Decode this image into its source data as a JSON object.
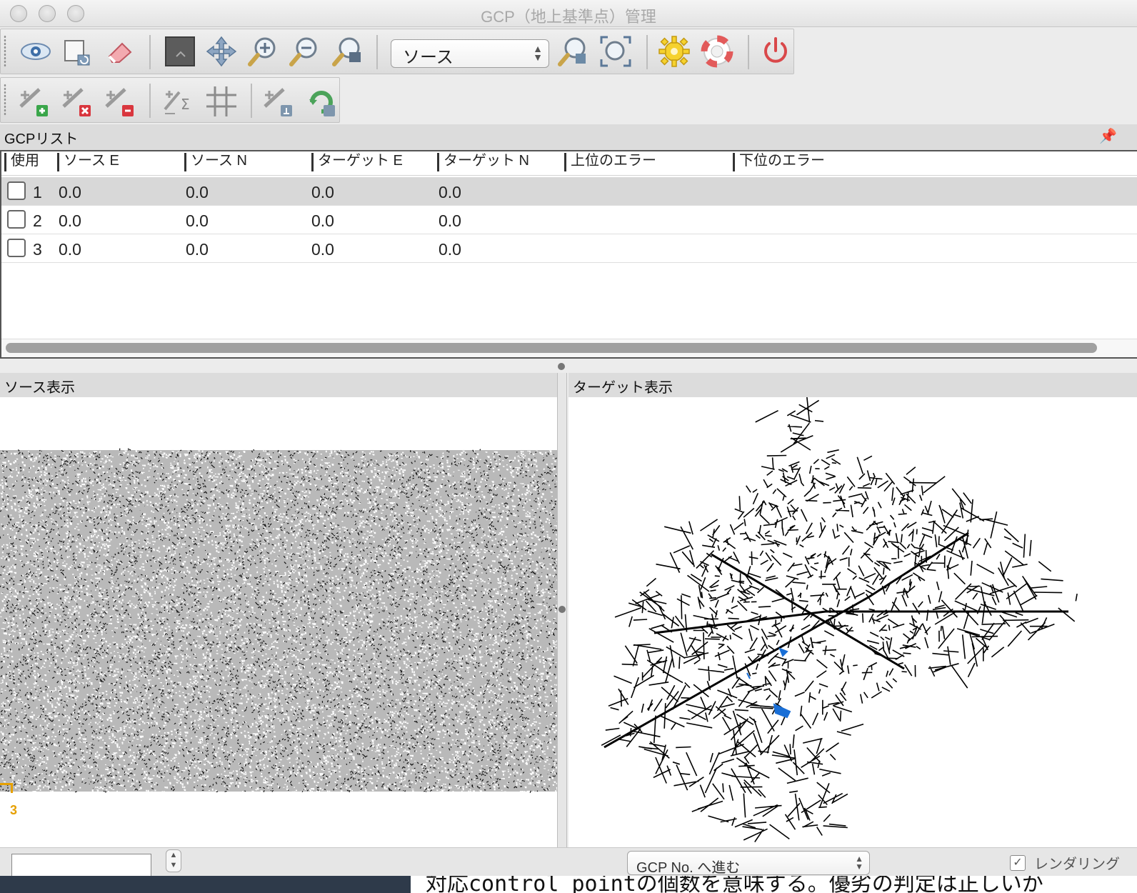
{
  "window": {
    "title": "GCP（地上基準点）管理"
  },
  "toolbar": {
    "view_selector": "ソース"
  },
  "gcp_list": {
    "title": "GCPリスト",
    "columns": [
      "使用",
      "ソース E",
      "ソース N",
      "ターゲット E",
      "ターゲット N",
      "上位のエラー",
      "下位のエラー"
    ],
    "rows": [
      {
        "id": "1",
        "source_e": "0.0",
        "source_n": "0.0",
        "target_e": "0.0",
        "target_n": "0.0"
      },
      {
        "id": "2",
        "source_e": "0.0",
        "source_n": "0.0",
        "target_e": "0.0",
        "target_n": "0.0"
      },
      {
        "id": "3",
        "source_e": "0.0",
        "source_n": "0.0",
        "target_e": "0.0",
        "target_n": "0.0"
      }
    ]
  },
  "source_view": {
    "title": "ソース表示",
    "marker_label": "3"
  },
  "target_view": {
    "title": "ターゲット表示"
  },
  "statusbar": {
    "goto_label": "GCP No. へ進む",
    "render_label": "レンダリング"
  },
  "underlying_text": "対応control pointの個数を意味する。優劣の判定は正しいか",
  "colors": {
    "road": "#000000",
    "water": "#1a6fd6",
    "marker": "#e6a000"
  }
}
